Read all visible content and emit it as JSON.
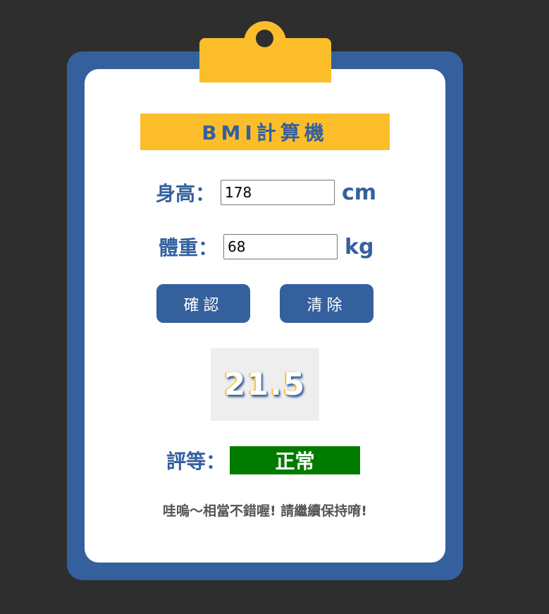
{
  "title": "BMI計算機",
  "height_field": {
    "label": "身高：",
    "value": "178",
    "unit": "cm"
  },
  "weight_field": {
    "label": "體重：",
    "value": "68",
    "unit": "kg"
  },
  "buttons": {
    "confirm": "確認",
    "clear": "清除"
  },
  "result": {
    "bmi": "21.5"
  },
  "grade": {
    "label": "評等：",
    "value": "正常",
    "color": "#007b00"
  },
  "message": "哇嗚～相當不錯喔! 請繼續保持唷!",
  "colors": {
    "background": "#2e2e2e",
    "board": "#34609e",
    "accent": "#fbbe2a",
    "paper": "#ffffff"
  },
  "icons": {
    "clip": "clipboard-clip-icon"
  }
}
